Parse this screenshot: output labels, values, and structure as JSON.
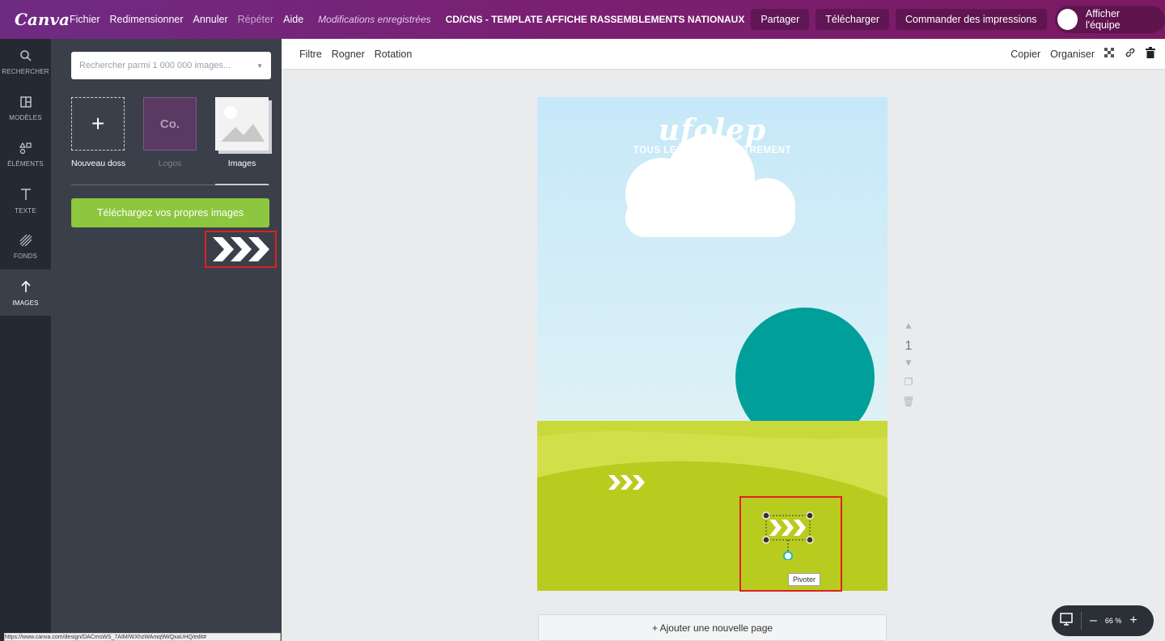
{
  "topbar": {
    "logo": "Canva",
    "menu": [
      "Fichier",
      "Redimensionner",
      "Annuler",
      "Répéter",
      "Aide"
    ],
    "saved_status": "Modifications enregistrées",
    "doc_title": "CD/CNS - TEMPLATE AFFICHE RASSEMBLEMENTS NATIONAUX",
    "share": "Partager",
    "download": "Télécharger",
    "order_prints": "Commander des impressions",
    "show_team": "Afficher l'équipe"
  },
  "rail": [
    {
      "label": "RECHERCHER",
      "icon": "search-icon"
    },
    {
      "label": "MODÈLES",
      "icon": "templates-icon"
    },
    {
      "label": "ÉLÉMENTS",
      "icon": "elements-icon"
    },
    {
      "label": "TEXTE",
      "icon": "text-icon"
    },
    {
      "label": "FONDS",
      "icon": "backgrounds-icon"
    },
    {
      "label": "IMAGES",
      "icon": "upload-icon"
    }
  ],
  "panel": {
    "search_placeholder": "Rechercher parmi 1 000 000 images...",
    "folders": [
      {
        "label": "Nouveau doss",
        "thumb": "+"
      },
      {
        "label": "Logos",
        "thumb": "Co."
      },
      {
        "label": "Images",
        "thumb": ""
      }
    ],
    "upload_button": "Téléchargez vos propres images"
  },
  "toolbar": {
    "filter": "Filtre",
    "crop": "Rogner",
    "rotation": "Rotation",
    "copy": "Copier",
    "arrange": "Organiser"
  },
  "page": {
    "brand": "ufolep",
    "tagline": "TOUS LES SPORTS AUTREMENT",
    "number": "1",
    "pivot_tooltip": "Pivoter"
  },
  "add_page": "+ Ajouter une nouvelle page",
  "zoom": {
    "value": "66 %",
    "minus": "–",
    "plus": "+"
  },
  "status_url": "https://www.canva.com/design/DACmsWS_7AIM/WXhzWAmq9WQxaUHQ/edit#",
  "colors": {
    "topbar": "#7a1f72",
    "upload_button": "#8dc63f",
    "circle": "#009f9a",
    "grass": "#b8cc1f",
    "highlight": "#e02020"
  }
}
